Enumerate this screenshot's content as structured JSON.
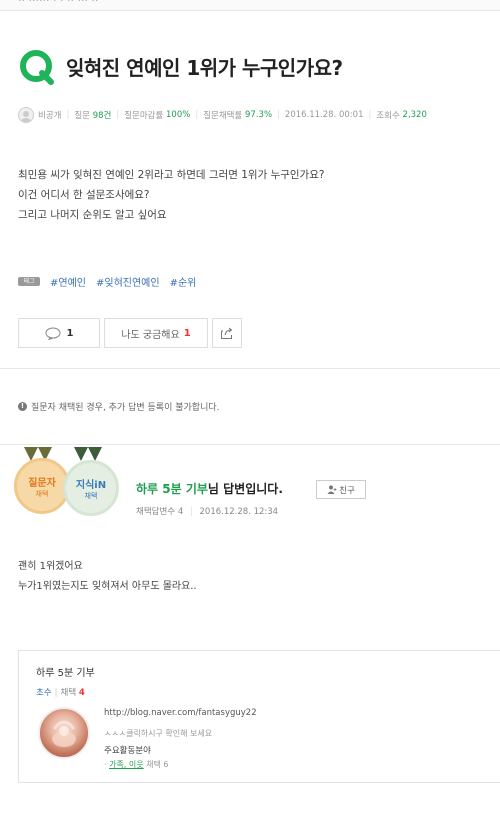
{
  "header": {
    "top_cut_text": "·· ······  ·   ·  ·· ···  ··"
  },
  "question": {
    "title": "잊혀진 연예인 1위가 누구인가요?",
    "meta": {
      "author": "비공개",
      "questions_label": "질문",
      "questions_value": "98건",
      "deadline_label": "질문마감률",
      "deadline_value": "100%",
      "adopt_label": "질문채택률",
      "adopt_value": "97.3%",
      "datetime": "2016.11.28. 00:01",
      "views_label": "조회수",
      "views_value": "2,320"
    },
    "body": [
      "최민용 씨가 잊혀진 연예인 2위라고 하면데 그러면 1위가 누구인가요?",
      "이건 어디서 한 설문조사에요?",
      "그리고 나머지 순위도 알고 싶어요"
    ],
    "tag_icon": "태그",
    "tags": [
      "#연예인",
      "#잊혀진연예인",
      "#순위"
    ],
    "comment_count": "1",
    "curious_label": "나도 궁금해요",
    "curious_count": "1"
  },
  "notice": {
    "text": "질문자 채택된 경우, 추가 답변 등록이 불가합니다."
  },
  "answer": {
    "badge1_line1": "질문자",
    "badge1_line2": "채택",
    "badge2_line1": "지식iN",
    "badge2_line2": "채택",
    "answerer_name": "하루 5분 기부",
    "answerer_suffix": "님 답변입니다.",
    "friend_label": "친구",
    "adopted_label": "채택답변수",
    "adopted_value": "4",
    "date": "2016.12.28. 12:34",
    "body": [
      "괜히 1위겠어요",
      "누가1위였는지도 잊혀져서 아무도 몰라요.."
    ]
  },
  "profile": {
    "name": "하루 5분 기부",
    "rank": "초수",
    "adopt_label": "채택",
    "adopt_count": "4",
    "url": "http://blog.naver.com/fantasyguy22",
    "desc": "ㅅㅅㅅ클릭하시구 확인해 보세요",
    "area_label": "주요활동분야",
    "field_link": "가족, 이웃",
    "field_adopt": "채택 6"
  },
  "colors": {
    "accent_green": "#1f9e4f",
    "link_blue": "#3b6fb6",
    "count_red": "#e33333"
  }
}
